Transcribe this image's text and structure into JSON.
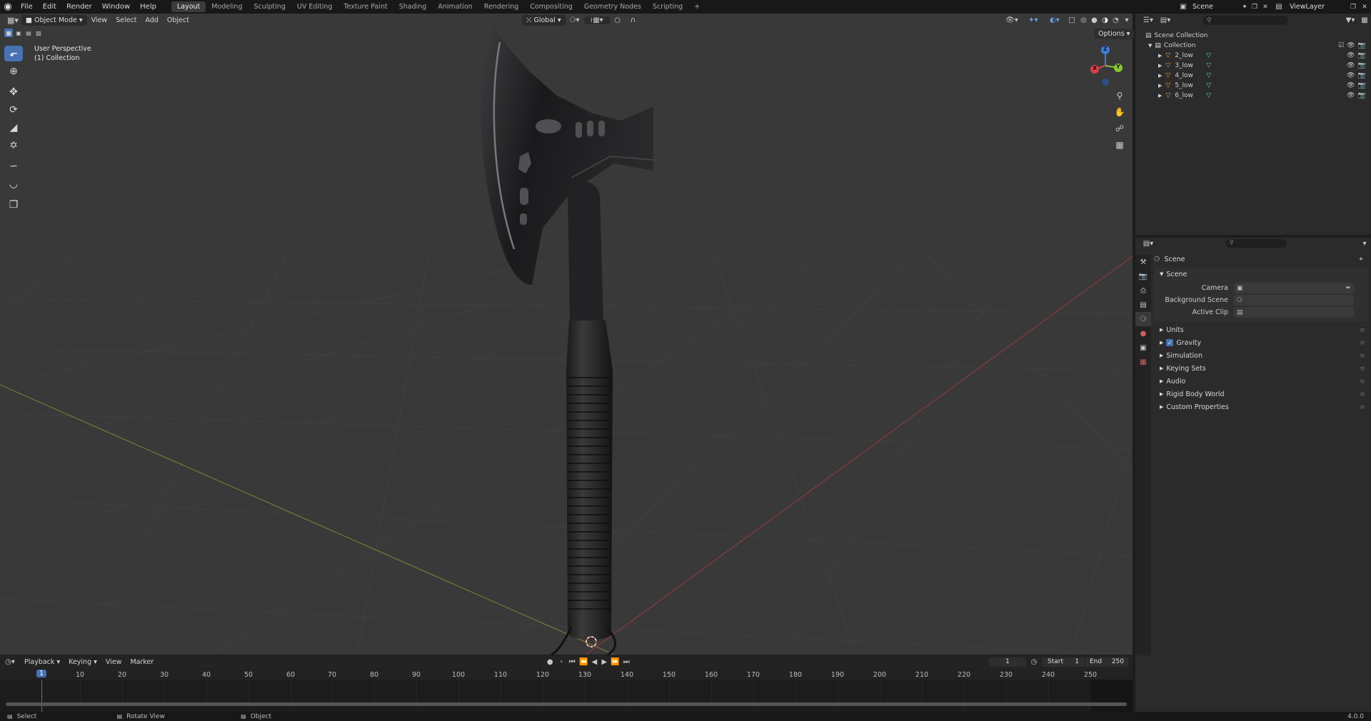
{
  "topbar": {
    "menus": [
      "File",
      "Edit",
      "Render",
      "Window",
      "Help"
    ],
    "workspaces": [
      "Layout",
      "Modeling",
      "Sculpting",
      "UV Editing",
      "Texture Paint",
      "Shading",
      "Animation",
      "Rendering",
      "Compositing",
      "Geometry Nodes",
      "Scripting"
    ],
    "active_workspace": "Layout",
    "add_tab": "+",
    "scene_name": "Scene",
    "view_layer_name": "ViewLayer"
  },
  "viewport": {
    "mode": "Object Mode",
    "menus": [
      "View",
      "Select",
      "Add",
      "Object"
    ],
    "transform_orientation": "Global",
    "options_label": "Options",
    "info_line1": "User Perspective",
    "info_line2": "(1) Collection",
    "gizmo_axes": {
      "x": "X",
      "y": "Y",
      "z": "Z"
    },
    "axis_colors": {
      "x": "#d9434d",
      "y": "#87c735",
      "z": "#3f7ddb"
    }
  },
  "outliner": {
    "root": "Scene Collection",
    "collection": "Collection",
    "items": [
      {
        "name": "2_low"
      },
      {
        "name": "3_low"
      },
      {
        "name": "4_low"
      },
      {
        "name": "5_low"
      },
      {
        "name": "6_low"
      }
    ]
  },
  "properties": {
    "title": "Scene",
    "panel_title": "Scene",
    "fields": [
      {
        "label": "Camera",
        "value": ""
      },
      {
        "label": "Background Scene",
        "value": ""
      },
      {
        "label": "Active Clip",
        "value": ""
      }
    ],
    "sections": [
      "Units",
      "Gravity",
      "Simulation",
      "Keying Sets",
      "Audio",
      "Rigid Body World",
      "Custom Properties"
    ],
    "gravity_enabled": true
  },
  "timeline": {
    "menus": [
      "Playback",
      "Keying",
      "View",
      "Marker"
    ],
    "current_frame": "1",
    "start_label": "Start",
    "start": "1",
    "end_label": "End",
    "end": "250",
    "ticks": [
      "1",
      "10",
      "20",
      "30",
      "40",
      "50",
      "60",
      "70",
      "80",
      "90",
      "100",
      "110",
      "120",
      "130",
      "140",
      "150",
      "160",
      "170",
      "180",
      "190",
      "200",
      "210",
      "220",
      "230",
      "240",
      "250"
    ]
  },
  "statusbar": {
    "select": "Select",
    "rotate": "Rotate View",
    "object": "Object",
    "version": "4.0.0"
  }
}
